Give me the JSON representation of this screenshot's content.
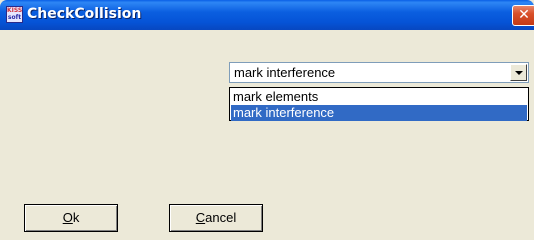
{
  "window": {
    "title": "CheckCollision",
    "app_icon": "kiss-app-icon",
    "app_icon_text_top": "KISS",
    "app_icon_text_bottom": "soft",
    "close_glyph": "✕"
  },
  "combo": {
    "selected_value": "mark interference",
    "options": [
      {
        "label": "mark elements",
        "selected": false
      },
      {
        "label": "mark interference",
        "selected": true
      }
    ],
    "highlight_color": "#316ac5"
  },
  "buttons": {
    "ok": {
      "mnemonic": "O",
      "rest": "k"
    },
    "cancel": {
      "mnemonic": "C",
      "rest": "ancel"
    }
  }
}
